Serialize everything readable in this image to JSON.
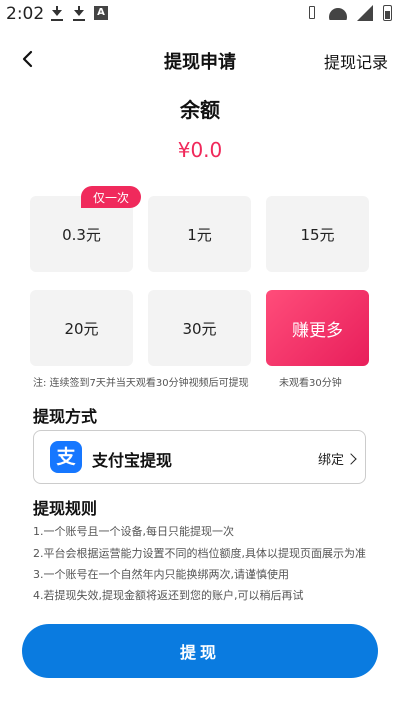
{
  "status_bar": {
    "time": "2:02",
    "app_badge": "A"
  },
  "header": {
    "title": "提现申请",
    "history_link": "提现记录"
  },
  "balance": {
    "label": "余额",
    "value": "¥0.0"
  },
  "amounts": {
    "badge": "仅一次",
    "options": [
      "0.3元",
      "1元",
      "15元",
      "20元",
      "30元",
      "赚更多"
    ]
  },
  "note": {
    "main": "注: 连续签到7天并当天观看30分钟视频后可提现",
    "status": "未观看30分钟"
  },
  "payment": {
    "title": "提现方式",
    "icon_char": "支",
    "method_name": "支付宝提现",
    "bind_label": "绑定"
  },
  "rules": {
    "title": "提现规则",
    "items": [
      "1.一个账号且一个设备,每日只能提现一次",
      "2.平台会根据运营能力设置不同的档位额度,具体以提现页面展示为准",
      "3.一个账号在一个自然年内只能换绑两次,请谨慎使用",
      "4.若提现失效,提现金额将返还到您的账户,可以稍后再试"
    ]
  },
  "submit": {
    "label": "提现"
  },
  "colors": {
    "accent_pink": "#f0285a",
    "accent_blue": "#0a7be0",
    "alipay_blue": "#1677ff"
  }
}
